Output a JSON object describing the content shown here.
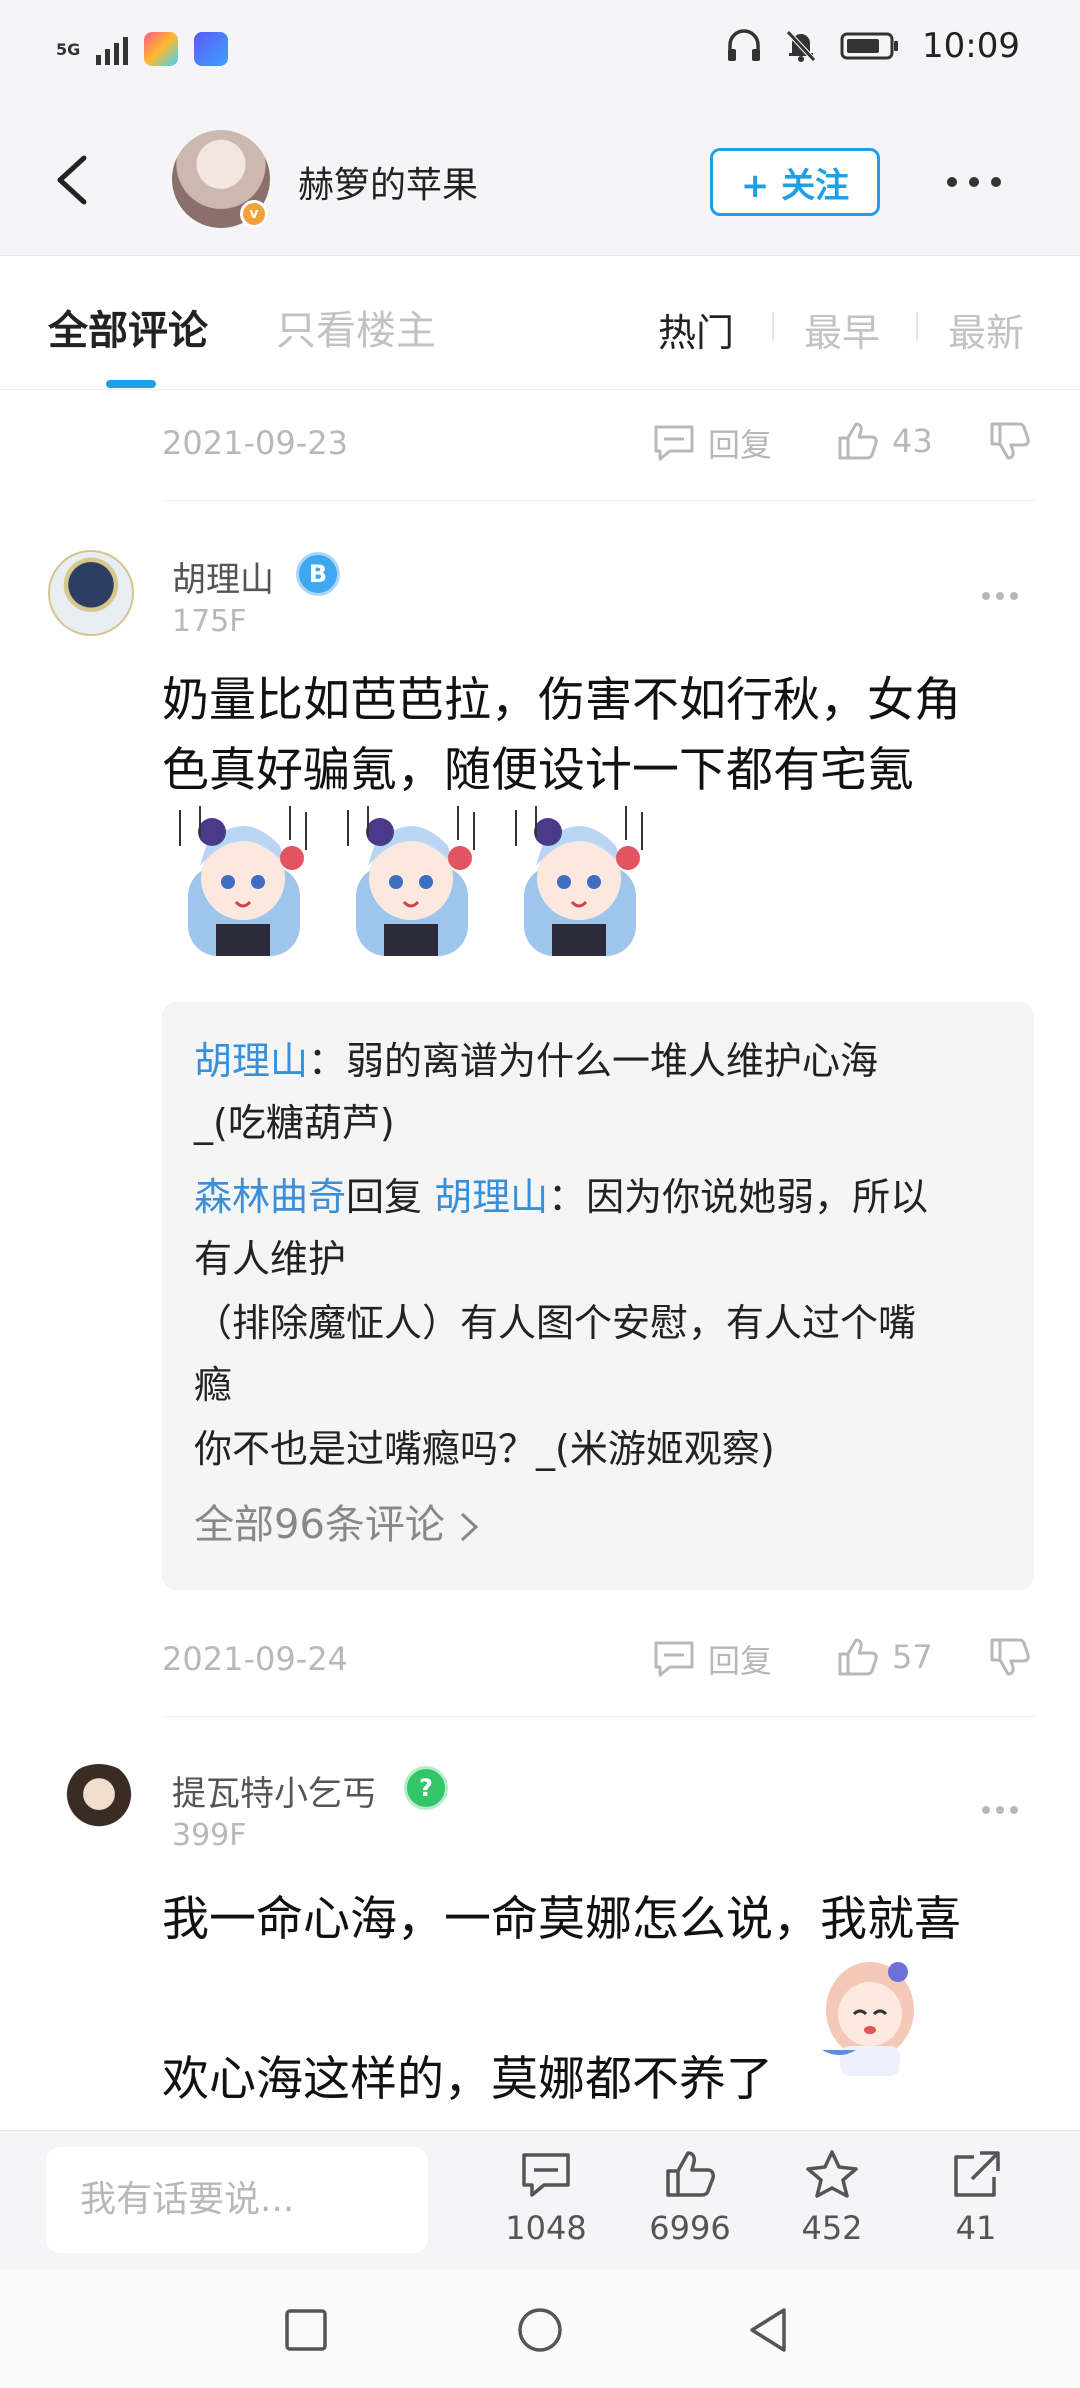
{
  "status_bar": {
    "network": "5G",
    "time": "10:09"
  },
  "header": {
    "username": "赫箩的苹果",
    "follow_label": "+ 关注",
    "badge": "v"
  },
  "tabs": {
    "all": "全部评论",
    "owner_only": "只看楼主",
    "sort_hot": "热门",
    "sort_earliest": "最早",
    "sort_newest": "最新"
  },
  "comment_prev": {
    "date": "2021-09-23",
    "reply_label": "回复",
    "likes": "43"
  },
  "comment_175": {
    "name": "胡理山",
    "level_badge": "B",
    "floor": "175F",
    "text_line1": "奶量比如芭芭拉，伤害不如行秋，女角",
    "text_line2": "色真好骗氪，随便设计一下都有宅氪",
    "replies": {
      "r1_user": "胡理山",
      "r1_text": "：弱的离谱为什么一堆人维护心海",
      "r1_text2": "_(吃糖葫芦)",
      "r2_user": "森林曲奇",
      "r2_mid": "回复 ",
      "r2_target": "胡理山",
      "r2_text": "：因为你说她弱，所以",
      "r2_text2": "有人维护",
      "r2_text3": "（排除魔怔人）有人图个安慰，有人过个嘴",
      "r2_text4": "瘾",
      "r2_text5": "你不也是过嘴瘾吗？_(米游姬观察)",
      "all_label": "全部96条评论"
    },
    "date": "2021-09-24",
    "reply_label": "回复",
    "likes": "57"
  },
  "comment_399": {
    "name": "提瓦特小乞丐",
    "level_badge": "?",
    "floor": "399F",
    "text_line1": "我一命心海，一命莫娜怎么说，我就喜",
    "text_line2": "欢心海这样的，莫娜都不养了"
  },
  "bottom_bar": {
    "input_placeholder": "我有话要说...",
    "comments": "1048",
    "likes": "6996",
    "favorites": "452",
    "shares": "41"
  },
  "colors": {
    "accent": "#1f9fe6",
    "reply_name": "#3a8fd6"
  }
}
